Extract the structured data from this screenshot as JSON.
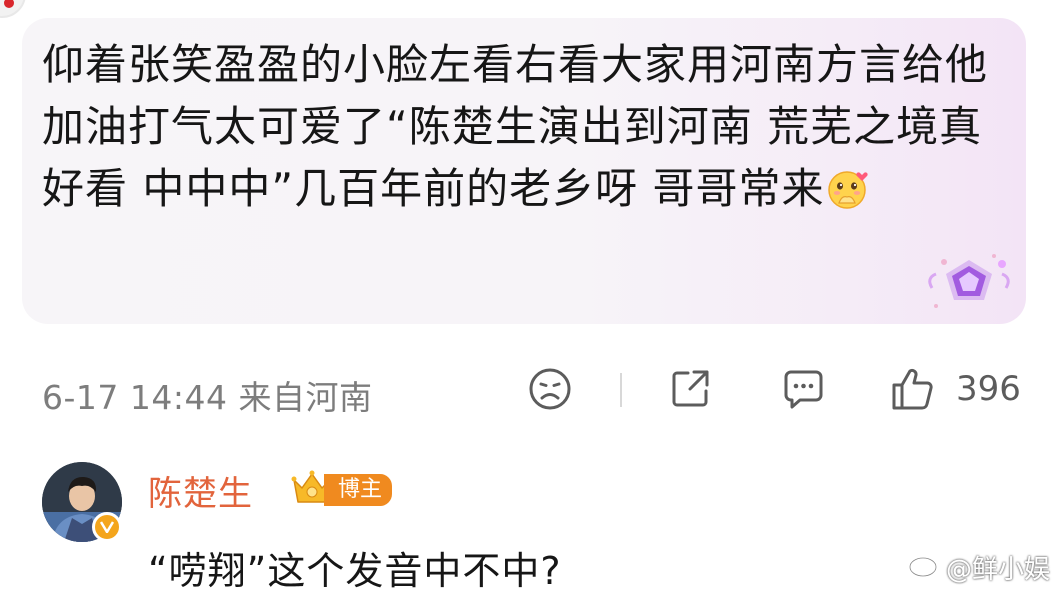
{
  "comment": {
    "text": "仰着张笑盈盈的小脸左看右看大家用河南方言给他加油打气太可爱了“陈楚生演出到河南 荒芜之境真好看 中中中”几百年前的老乡呀 哥哥常来",
    "emoji_icon": "pleading-hands-emoji-icon",
    "decoration_icon": "purple-diamond-badge-icon"
  },
  "meta": {
    "timestamp": "6-17 14:44 来自河南",
    "like_count": "396",
    "actions": [
      "dislike-face-icon",
      "share-icon",
      "comment-icon",
      "thumbs-up-icon"
    ]
  },
  "reply": {
    "author": "陈楚生",
    "author_badge": "博主",
    "text": "“唠翔”这个发音中不中?",
    "name_color": "#e2643c",
    "badge_color": "#f08a1f"
  },
  "watermark": {
    "text": "@鲜小娱"
  }
}
